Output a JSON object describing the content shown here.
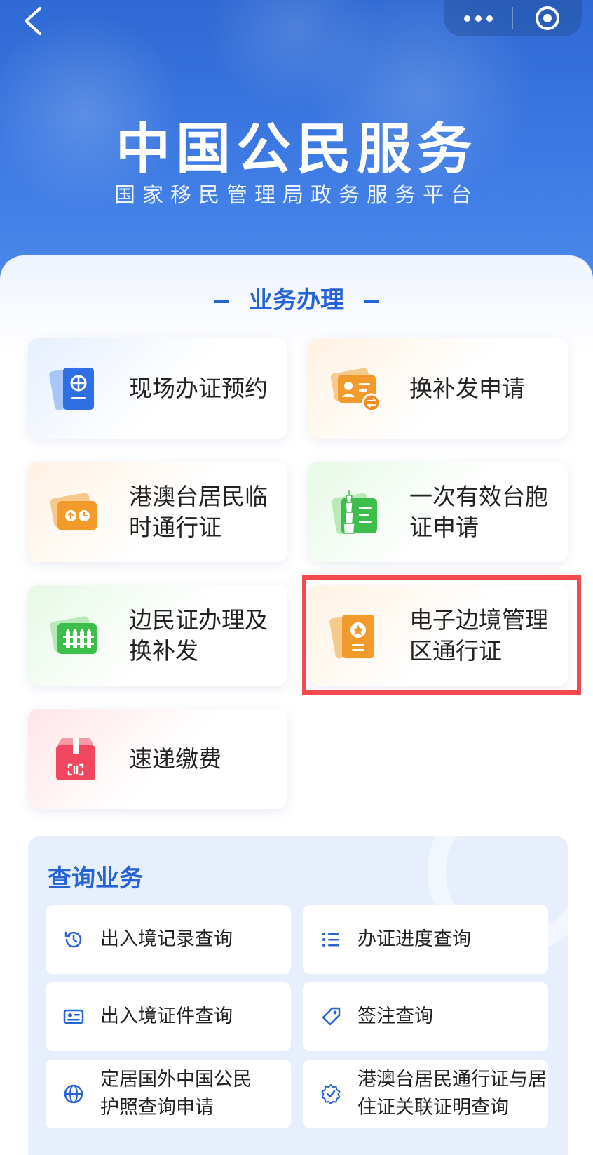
{
  "header": {
    "title": "中国公民服务",
    "subtitle": "国家移民管理局政务服务平台"
  },
  "section": {
    "title": "业务办理"
  },
  "cards": [
    {
      "label": "现场办证预约",
      "icon": "passport-globe-icon",
      "theme": "blue"
    },
    {
      "label": "换补发申请",
      "icon": "id-card-exchange-icon",
      "theme": "orange"
    },
    {
      "label": "港澳台居民临时通行证",
      "icon": "temporary-pass-icon",
      "theme": "orange"
    },
    {
      "label": "一次有效台胞证申请",
      "icon": "taiwan-permit-icon",
      "theme": "green"
    },
    {
      "label": "边民证办理及换补发",
      "icon": "border-fence-icon",
      "theme": "green"
    },
    {
      "label": "电子边境管理区通行证",
      "icon": "star-document-icon",
      "theme": "orange"
    },
    {
      "label": "速递缴费",
      "icon": "express-package-icon",
      "theme": "red"
    }
  ],
  "query": {
    "title": "查询业务",
    "items": [
      {
        "label": "出入境记录查询",
        "icon": "clock-history-icon"
      },
      {
        "label": "办证进度查询",
        "icon": "checklist-icon"
      },
      {
        "label": "出入境证件查询",
        "icon": "id-card-icon"
      },
      {
        "label": "签注查询",
        "icon": "tag-icon"
      },
      {
        "label": "定居国外中国公民护照查询申请",
        "icon": "globe-icon"
      },
      {
        "label": "港澳台居民通行证与居住证关联证明查询",
        "icon": "verified-badge-icon"
      }
    ]
  },
  "colors": {
    "primary": "#2563d6",
    "highlight": "#f24a4f",
    "orange": "#f39a2c",
    "green": "#3bbf4a",
    "red": "#f0475e"
  }
}
